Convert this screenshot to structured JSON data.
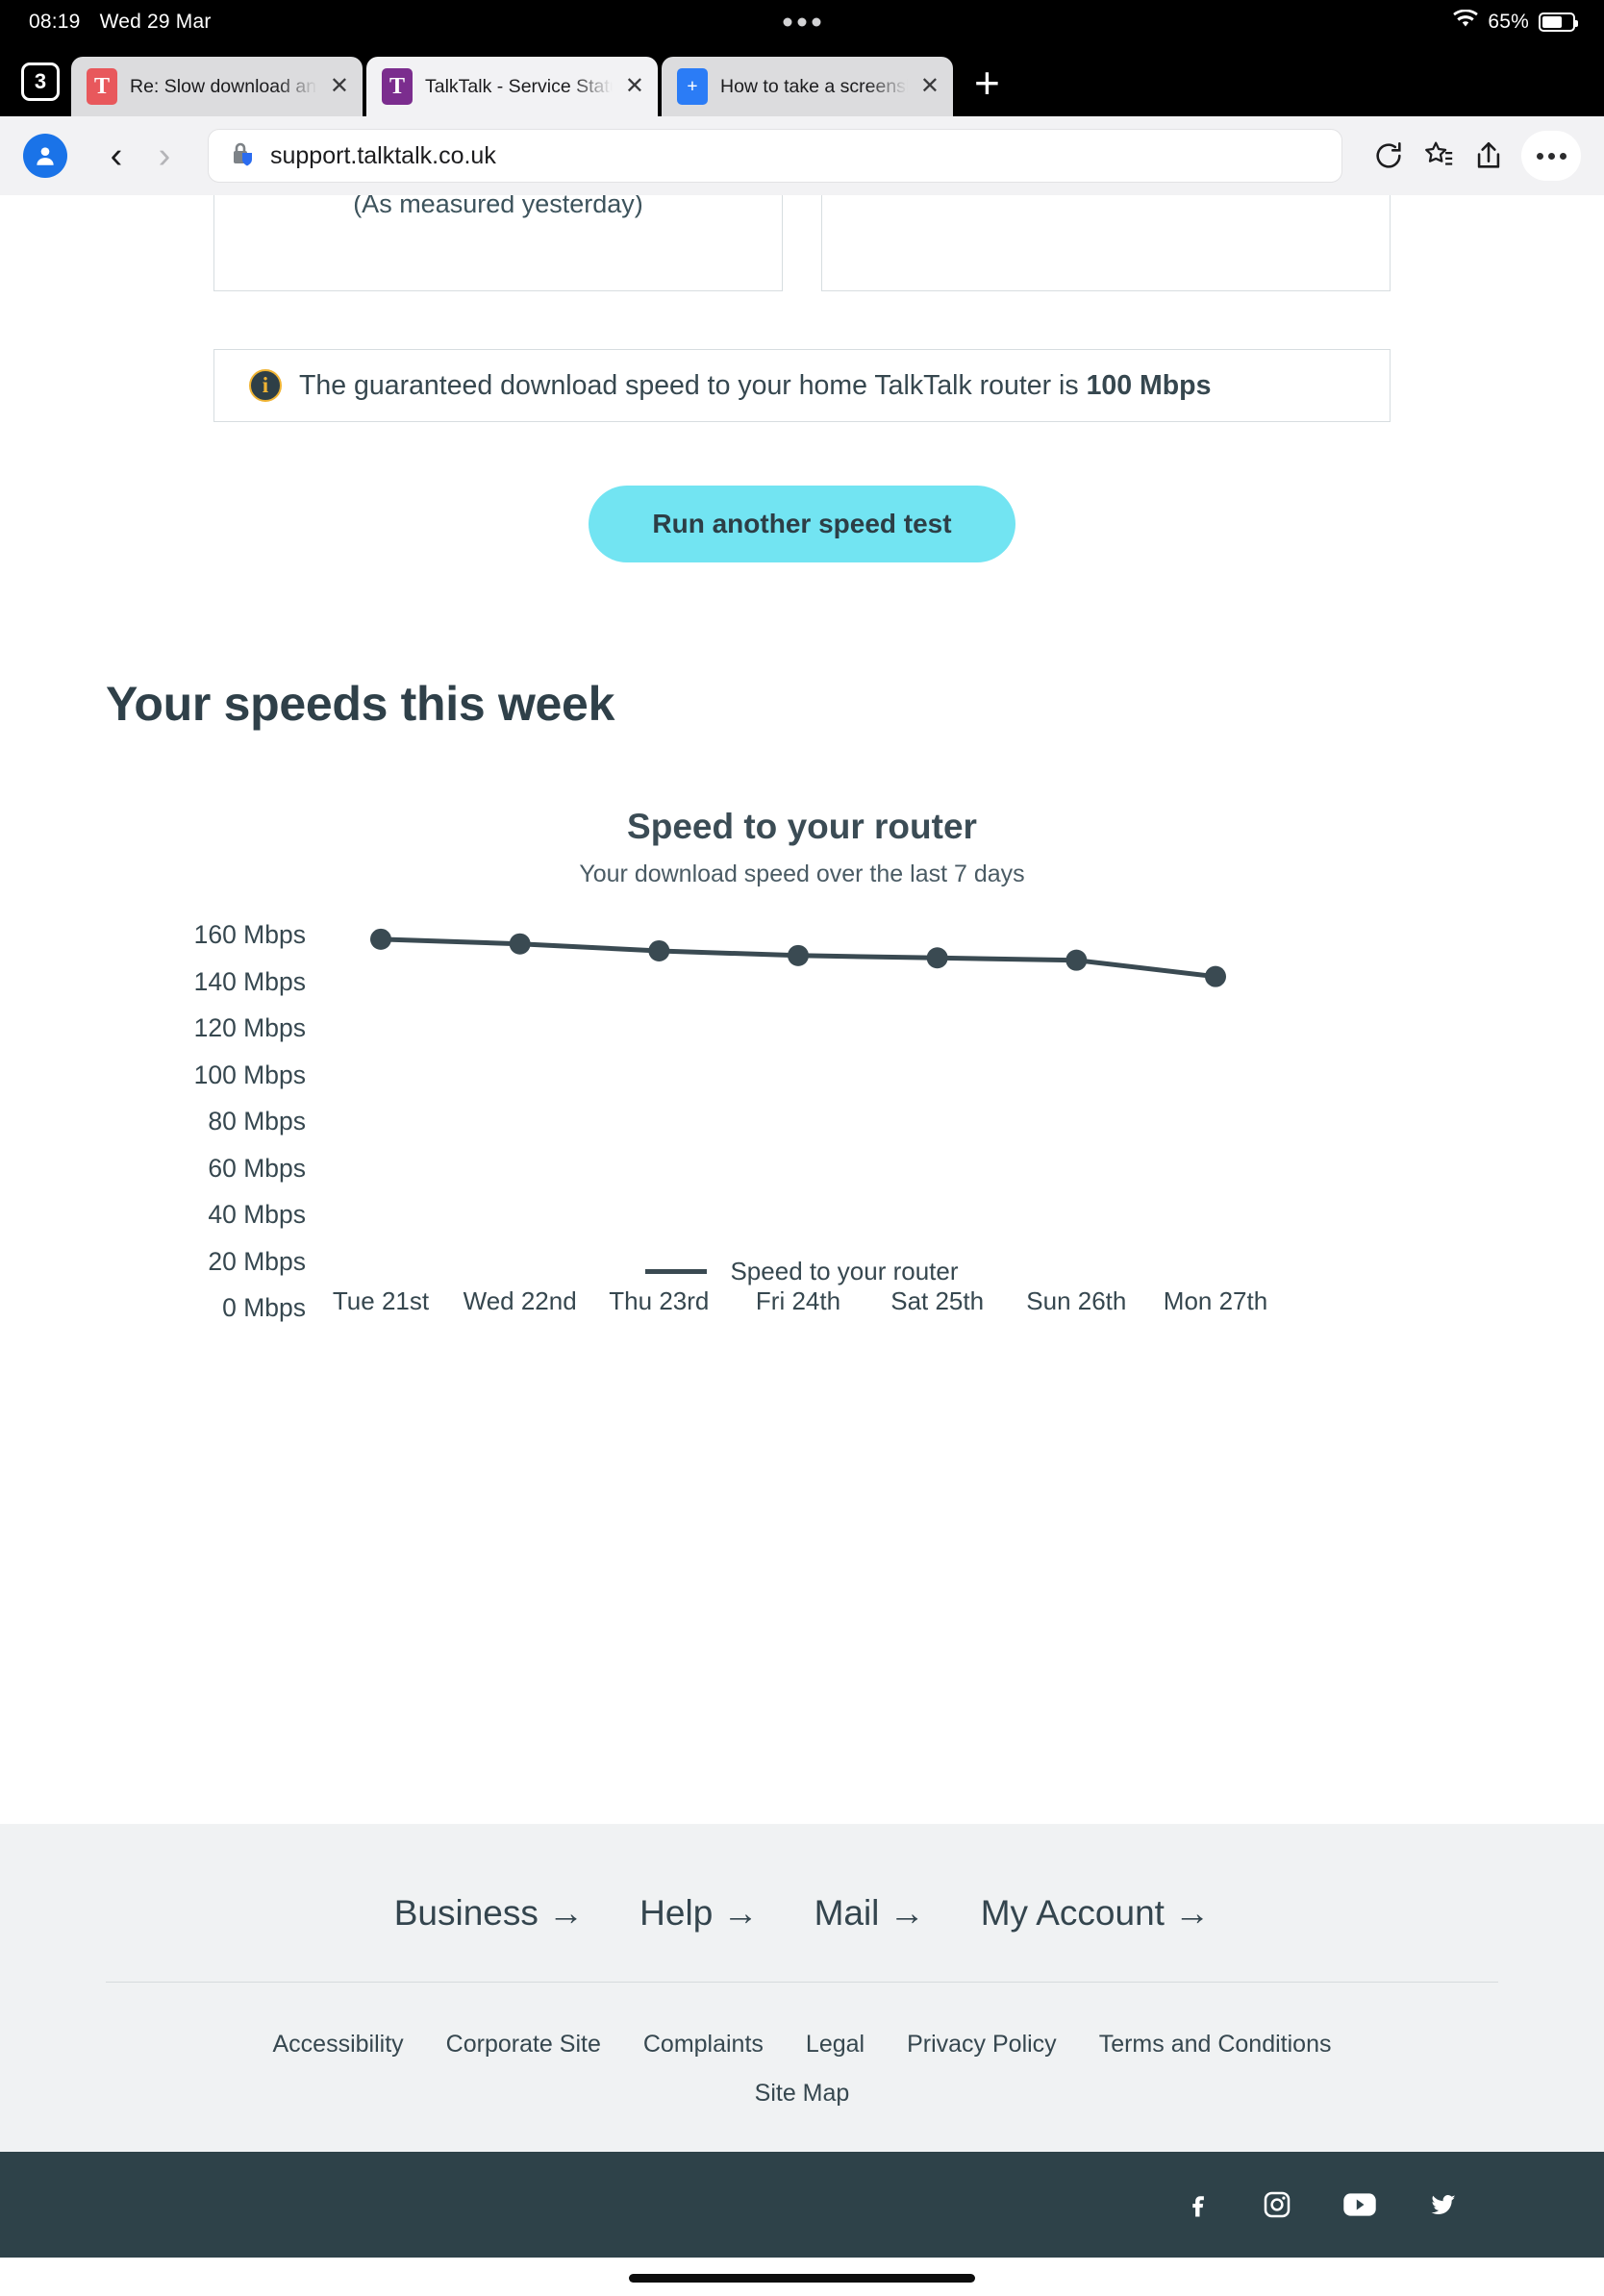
{
  "status_bar": {
    "time": "08:19",
    "date": "Wed 29 Mar",
    "battery_percent": "65%"
  },
  "browser": {
    "tab_count": "3",
    "tabs": [
      {
        "title": "Re: Slow download and high",
        "favicon_letter": "T",
        "favicon_color": "#e8585c",
        "active": false
      },
      {
        "title": "TalkTalk - Service Status",
        "favicon_letter": "T",
        "favicon_color": "#7b2d8e",
        "active": true
      },
      {
        "title": "How to take a screenshot on",
        "favicon_letter": "+",
        "favicon_color": "#2b7cf6",
        "active": false
      }
    ],
    "new_tab_label": "+",
    "close_label": "✕",
    "url": "support.talktalk.co.uk",
    "back_label": "‹",
    "forward_label": "›"
  },
  "page": {
    "card_note": "(As measured yesterday)",
    "info_banner": {
      "icon": "i",
      "text_before": "The guaranteed download speed to your home TalkTalk router is ",
      "value": "100 Mbps"
    },
    "cta_label": "Run another speed test",
    "section_heading": "Your speeds this week"
  },
  "chart_data": {
    "type": "line",
    "title": "Speed to your router",
    "subtitle": "Your download speed over the last 7 days",
    "xlabel": "",
    "ylabel": "",
    "categories": [
      "Tue 21st",
      "Wed 22nd",
      "Thu 23rd",
      "Fri 24th",
      "Sat 25th",
      "Sun 26th",
      "Mon 27th"
    ],
    "ytick_labels": [
      "160 Mbps",
      "140 Mbps",
      "120 Mbps",
      "100 Mbps",
      "80 Mbps",
      "60 Mbps",
      "40 Mbps",
      "20 Mbps",
      "0 Mbps"
    ],
    "ytick_values": [
      160,
      140,
      120,
      100,
      80,
      60,
      40,
      20,
      0
    ],
    "ylim": [
      0,
      160
    ],
    "grid": false,
    "legend": [
      {
        "name": "Speed to your router",
        "color": "#3a4a52"
      }
    ],
    "legend_position": "bottom",
    "series": [
      {
        "name": "Speed to your router",
        "color": "#3a4a52",
        "values": [
          158,
          156,
          153,
          151,
          150,
          149,
          142
        ]
      }
    ]
  },
  "footer": {
    "primary_links": [
      {
        "label": "Business",
        "arrow": "→"
      },
      {
        "label": "Help",
        "arrow": "→"
      },
      {
        "label": "Mail",
        "arrow": "→"
      },
      {
        "label": "My Account",
        "arrow": "→"
      }
    ],
    "secondary_links": [
      "Accessibility",
      "Corporate Site",
      "Complaints",
      "Legal",
      "Privacy Policy",
      "Terms and Conditions"
    ],
    "site_map": "Site Map",
    "social": [
      "facebook-icon",
      "instagram-icon",
      "youtube-icon",
      "twitter-icon"
    ]
  }
}
